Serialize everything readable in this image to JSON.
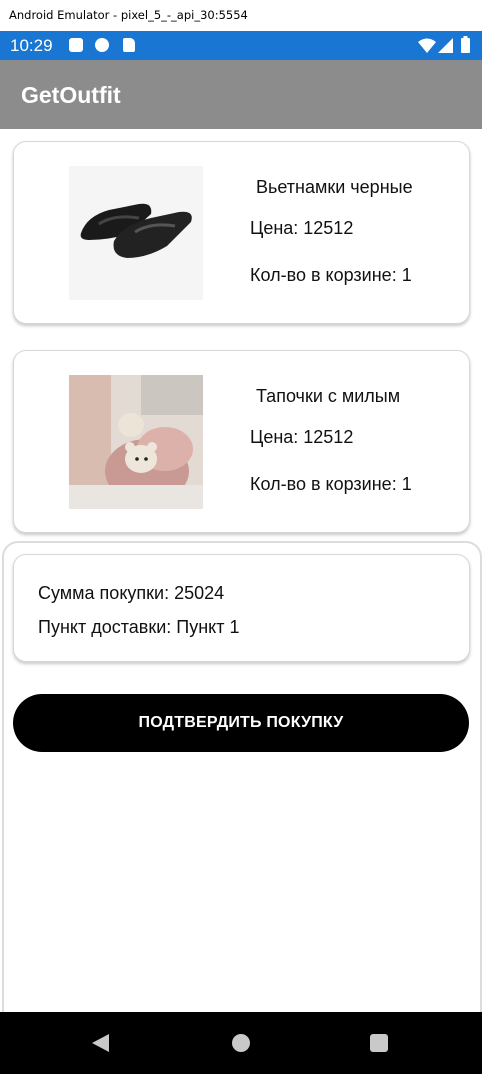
{
  "window": {
    "title": "Android Emulator - pixel_5_-_api_30:5554"
  },
  "status_bar": {
    "time": "10:29"
  },
  "app": {
    "title": "GetOutfit"
  },
  "cart": {
    "items": [
      {
        "name": "Вьетнамки черные",
        "price": "Цена: 12512",
        "quantity": "Кол-во в корзине: 1"
      },
      {
        "name": "Тапочки с милым",
        "price": "Цена: 12512",
        "quantity": "Кол-во в корзине: 1"
      }
    ]
  },
  "summary": {
    "total": "Сумма покупки: 25024",
    "delivery": "Пункт доставки: Пункт 1"
  },
  "actions": {
    "confirm_label": "ПОДТВЕРДИТЬ ПОКУПКУ"
  },
  "icons": {
    "status": [
      "a-icon",
      "p-icon",
      "sd-card-icon",
      "wifi-icon",
      "signal-icon",
      "battery-icon"
    ],
    "nav": [
      "back-icon",
      "home-icon",
      "recents-icon"
    ]
  }
}
